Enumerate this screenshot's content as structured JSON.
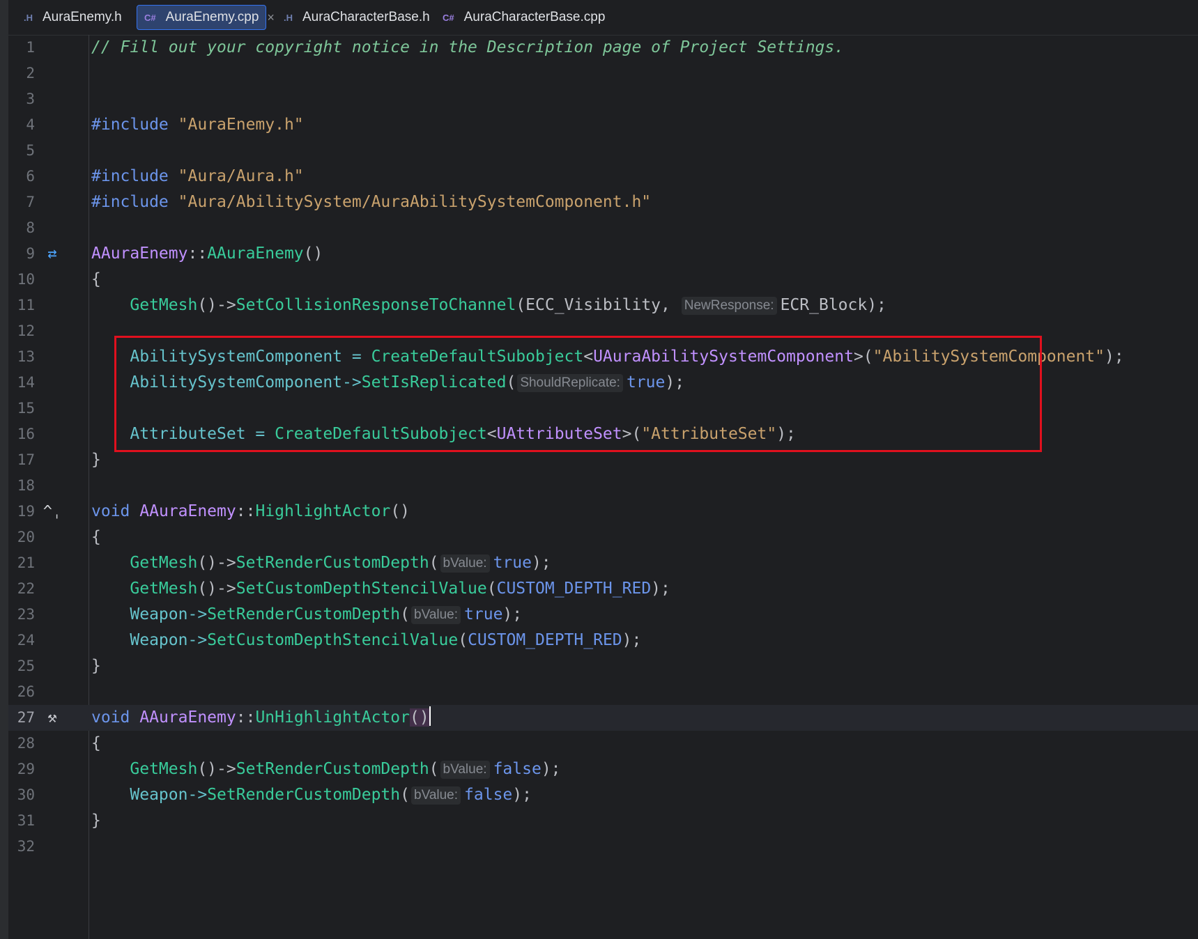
{
  "tabs": [
    {
      "label": "AuraEnemy.h",
      "icon": ".H",
      "active": false
    },
    {
      "label": "AuraEnemy.cpp",
      "icon": "C#",
      "active": true,
      "close": "×"
    },
    {
      "label": "AuraCharacterBase.h",
      "icon": ".H",
      "active": false
    },
    {
      "label": "AuraCharacterBase.cpp",
      "icon": "C#",
      "active": false
    }
  ],
  "line_numbers": [
    "1",
    "2",
    "3",
    "4",
    "5",
    "6",
    "7",
    "8",
    "9",
    "10",
    "11",
    "12",
    "13",
    "14",
    "15",
    "16",
    "17",
    "18",
    "19",
    "20",
    "21",
    "22",
    "23",
    "24",
    "25",
    "26",
    "27",
    "28",
    "29",
    "30",
    "31",
    "32"
  ],
  "code": {
    "l1": "// Fill out your copyright notice in the Description page of Project Settings.",
    "include": "#include",
    "inc1": "\"AuraEnemy.h\"",
    "inc2": "\"Aura/Aura.h\"",
    "inc3": "\"Aura/AbilitySystem/AuraAbilitySystemComponent.h\"",
    "class_name": "AAuraEnemy",
    "scope": "::",
    "ctor": "AAuraEnemy",
    "parens": "()",
    "open_brace": "{",
    "close_brace": "}",
    "void": "void",
    "getmesh": "GetMesh",
    "arrow": "()->",
    "set_collision": "SetCollisionResponseToChannel",
    "ecc_vis": "ECC_Visibility",
    "hint_newresponse": "NewResponse:",
    "ecr_block": "ECR_Block",
    "asc": "AbilitySystemComponent",
    "assign": " = ",
    "create_default": "CreateDefaultSubobject",
    "uaura_asc": "UAuraAbilitySystemComponent",
    "asc_str": "\"AbilitySystemComponent\"",
    "ptr_arrow": "->",
    "set_replicated": "SetIsReplicated",
    "hint_shouldreplicate": "ShouldReplicate:",
    "true": "true",
    "false": "false",
    "attrset": "AttributeSet",
    "uattrset": "UAttributeSet",
    "attrset_str": "\"AttributeSet\"",
    "highlight": "HighlightActor",
    "unhighlight": "UnHighlightActor",
    "set_render_depth": "SetRenderCustomDepth",
    "hint_bvalue": "bValue:",
    "set_stencil": "SetCustomDepthStencilValue",
    "custom_red": "CUSTOM_DEPTH_RED",
    "weapon": "Weapon"
  },
  "gutter_icons": {
    "line9": "implements-icon",
    "line19": "navigate-up-icon",
    "line27": "hammer-icon"
  },
  "colors": {
    "background": "#1e1f22",
    "comment": "#7ec699",
    "keyword": "#6c95eb",
    "string": "#c9a26d",
    "type": "#c191ff",
    "function": "#39cc9b",
    "variable": "#66c3cc",
    "highlight_box": "#e0101e",
    "active_tab": "#2e436e"
  }
}
